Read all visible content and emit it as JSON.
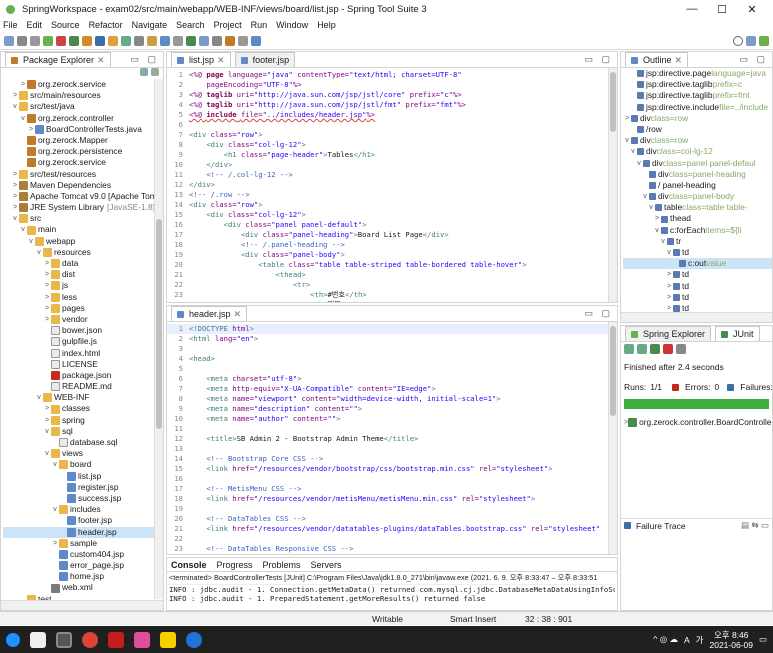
{
  "window": {
    "title": "SpringWorkspace - exam02/src/main/webapp/WEB-INF/views/board/list.jsp - Spring Tool Suite 3",
    "min": "—",
    "max": "☐",
    "close": "✕"
  },
  "menu": [
    "File",
    "Edit",
    "Source",
    "Refactor",
    "Navigate",
    "Search",
    "Project",
    "Run",
    "Window",
    "Help"
  ],
  "package_explorer": {
    "tab": "Package Explorer",
    "items": [
      {
        "indent": 2,
        "arrow": ">",
        "icon": "pkg",
        "label": "org.zerock.service"
      },
      {
        "indent": 1,
        "arrow": ">",
        "icon": "folder",
        "label": "src/main/resources"
      },
      {
        "indent": 1,
        "arrow": "v",
        "icon": "folder",
        "label": "src/test/java"
      },
      {
        "indent": 2,
        "arrow": "v",
        "icon": "pkg",
        "label": "org.zerock.controller"
      },
      {
        "indent": 3,
        "arrow": ">",
        "icon": "jfile",
        "label": "BoardControllerTests.java"
      },
      {
        "indent": 2,
        "arrow": "",
        "icon": "pkg",
        "label": "org.zerock.Mapper"
      },
      {
        "indent": 2,
        "arrow": "",
        "icon": "pkg",
        "label": "org.zerock.persistence"
      },
      {
        "indent": 2,
        "arrow": "",
        "icon": "pkg",
        "label": "org.zerock.service"
      },
      {
        "indent": 1,
        "arrow": ">",
        "icon": "folder",
        "label": "src/test/resources"
      },
      {
        "indent": 1,
        "arrow": ">",
        "icon": "jar",
        "label": "Maven Dependencies"
      },
      {
        "indent": 1,
        "arrow": ">",
        "icon": "jar",
        "label": "Apache Tomcat v9.0 [Apache Tom"
      },
      {
        "indent": 1,
        "arrow": ">",
        "icon": "jar",
        "label": "JRE System Library",
        "suffix": "[JavaSE-1.8]"
      },
      {
        "indent": 1,
        "arrow": "v",
        "icon": "folder",
        "label": "src"
      },
      {
        "indent": 2,
        "arrow": "v",
        "icon": "folder",
        "label": "main"
      },
      {
        "indent": 3,
        "arrow": "v",
        "icon": "folder",
        "label": "webapp"
      },
      {
        "indent": 4,
        "arrow": "v",
        "icon": "folder",
        "label": "resources"
      },
      {
        "indent": 5,
        "arrow": ">",
        "icon": "folder",
        "label": "data"
      },
      {
        "indent": 5,
        "arrow": ">",
        "icon": "folder",
        "label": "dist"
      },
      {
        "indent": 5,
        "arrow": ">",
        "icon": "folder",
        "label": "js"
      },
      {
        "indent": 5,
        "arrow": ">",
        "icon": "folder",
        "label": "less"
      },
      {
        "indent": 5,
        "arrow": ">",
        "icon": "folder",
        "label": "pages"
      },
      {
        "indent": 5,
        "arrow": ">",
        "icon": "folder",
        "label": "vendor"
      },
      {
        "indent": 5,
        "arrow": "",
        "icon": "file",
        "label": "bower.json"
      },
      {
        "indent": 5,
        "arrow": "",
        "icon": "file",
        "label": "gulpfile.js"
      },
      {
        "indent": 5,
        "arrow": "",
        "icon": "file",
        "label": "index.html"
      },
      {
        "indent": 5,
        "arrow": "",
        "icon": "file",
        "label": "LICENSE"
      },
      {
        "indent": 5,
        "arrow": "",
        "icon": "red",
        "label": "package.json"
      },
      {
        "indent": 5,
        "arrow": "",
        "icon": "file",
        "label": "README.md"
      },
      {
        "indent": 4,
        "arrow": "v",
        "icon": "folder",
        "label": "WEB-INF"
      },
      {
        "indent": 5,
        "arrow": ">",
        "icon": "folder",
        "label": "classes"
      },
      {
        "indent": 5,
        "arrow": ">",
        "icon": "folder",
        "label": "spring"
      },
      {
        "indent": 5,
        "arrow": "v",
        "icon": "folder",
        "label": "sql"
      },
      {
        "indent": 6,
        "arrow": "",
        "icon": "file",
        "label": "database.sql"
      },
      {
        "indent": 5,
        "arrow": "v",
        "icon": "folder",
        "label": "views"
      },
      {
        "indent": 6,
        "arrow": "v",
        "icon": "folder",
        "label": "board"
      },
      {
        "indent": 7,
        "arrow": "",
        "icon": "jsp",
        "label": "list.jsp"
      },
      {
        "indent": 7,
        "arrow": "",
        "icon": "jsp",
        "label": "register.jsp"
      },
      {
        "indent": 7,
        "arrow": "",
        "icon": "jsp",
        "label": "success.jsp"
      },
      {
        "indent": 6,
        "arrow": "v",
        "icon": "folder",
        "label": "includes"
      },
      {
        "indent": 7,
        "arrow": "",
        "icon": "jsp",
        "label": "footer.jsp"
      },
      {
        "indent": 7,
        "arrow": "",
        "icon": "jsp",
        "label": "header.jsp",
        "selected": true
      },
      {
        "indent": 6,
        "arrow": ">",
        "icon": "folder",
        "label": "sample"
      },
      {
        "indent": 6,
        "arrow": "",
        "icon": "jsp",
        "label": "custom404.jsp"
      },
      {
        "indent": 6,
        "arrow": "",
        "icon": "jsp",
        "label": "error_page.jsp"
      },
      {
        "indent": 6,
        "arrow": "",
        "icon": "jsp",
        "label": "home.jsp"
      },
      {
        "indent": 5,
        "arrow": "",
        "icon": "tag",
        "label": "web.xml"
      },
      {
        "indent": 2,
        "arrow": "",
        "icon": "folder",
        "label": "test"
      },
      {
        "indent": 1,
        "arrow": ">",
        "icon": "folder",
        "label": "target"
      }
    ]
  },
  "editor_top": {
    "tabs": [
      "list.jsp",
      "footer.jsp"
    ],
    "lines": [
      {
        "n": "1",
        "html": "<span class=\"at\">&lt;%@</span> <span class=\"kw\">page</span> <span class=\"at\">language=</span><span class=\"st\">\"java\"</span> <span class=\"at\">contentType=</span><span class=\"st\">\"text/html; charset=UTF-8\"</span>"
      },
      {
        "n": "2",
        "html": "    <span class=\"at\">pageEncoding=</span><span class=\"st\">\"UTF-8\"</span><span class=\"at\">%&gt;</span>"
      },
      {
        "n": "3",
        "html": "<span class=\"at\">&lt;%@</span> <span class=\"kw\">taglib</span> <span class=\"at\">uri=</span><span class=\"st\">\"http://java.sun.com/jsp/jstl/core\"</span> <span class=\"at\">prefix=</span><span class=\"st\">\"c\"</span><span class=\"at\">%&gt;</span>"
      },
      {
        "n": "4",
        "html": "<span class=\"at\">&lt;%@</span> <span class=\"kw\">taglib</span> <span class=\"at\">uri=</span><span class=\"st\">\"http://java.sun.com/jsp/jstl/fmt\"</span> <span class=\"at\">prefix=</span><span class=\"st\">\"fmt\"</span><span class=\"at\">%&gt;</span>"
      },
      {
        "n": "5",
        "html": "<span class=\"at\">&lt;%@</span> <span class=\"kw\">include</span> <span class=\"at\">file=</span><span class=\"st\">\"../includes/header.jsp\"</span><span class=\"at\">%&gt;</span>"
      },
      {
        "n": "6",
        "html": ""
      },
      {
        "n": "7",
        "html": "<span class=\"tg\">&lt;div</span> <span class=\"at\">class=</span><span class=\"st\">\"row\"</span><span class=\"tg\">&gt;</span>"
      },
      {
        "n": "8",
        "html": "    <span class=\"tg\">&lt;div</span> <span class=\"at\">class=</span><span class=\"st\">\"col-lg-12\"</span><span class=\"tg\">&gt;</span>"
      },
      {
        "n": "9",
        "html": "        <span class=\"tg\">&lt;h1</span> <span class=\"at\">class=</span><span class=\"st\">\"page-header\"</span><span class=\"tg\">&gt;</span>Tables<span class=\"tg\">&lt;/h1&gt;</span>"
      },
      {
        "n": "10",
        "html": "    <span class=\"tg\">&lt;/div&gt;</span>"
      },
      {
        "n": "11",
        "html": "    <span class=\"cm\">&lt;!-- /.col-lg-12 --&gt;</span>"
      },
      {
        "n": "12",
        "html": "<span class=\"tg\">&lt;/div&gt;</span>"
      },
      {
        "n": "13",
        "html": "<span class=\"cm\">&lt;!-- /.row --&gt;</span>"
      },
      {
        "n": "14",
        "html": "<span class=\"tg\">&lt;div</span> <span class=\"at\">class=</span><span class=\"st\">\"row\"</span><span class=\"tg\">&gt;</span>"
      },
      {
        "n": "15",
        "html": "    <span class=\"tg\">&lt;div</span> <span class=\"at\">class=</span><span class=\"st\">\"col-lg-12\"</span><span class=\"tg\">&gt;</span>"
      },
      {
        "n": "16",
        "html": "        <span class=\"tg\">&lt;div</span> <span class=\"at\">class=</span><span class=\"st\">\"panel panel-default\"</span><span class=\"tg\">&gt;</span>"
      },
      {
        "n": "17",
        "html": "            <span class=\"tg\">&lt;div</span> <span class=\"at\">class=</span><span class=\"st\">\"panel-heading\"</span><span class=\"tg\">&gt;</span>Board List Page<span class=\"tg\">&lt;/div&gt;</span>"
      },
      {
        "n": "18",
        "html": "            <span class=\"cm\">&lt;!-- /.panel-heading --&gt;</span>"
      },
      {
        "n": "19",
        "html": "            <span class=\"tg\">&lt;div</span> <span class=\"at\">class=</span><span class=\"st\">\"panel-body\"</span><span class=\"tg\">&gt;</span>"
      },
      {
        "n": "20",
        "html": "                <span class=\"tg\">&lt;table</span> <span class=\"at\">class=</span><span class=\"st\">\"table table-striped table-bordered table-hover\"</span><span class=\"tg\">&gt;</span>"
      },
      {
        "n": "21",
        "html": "                    <span class=\"tg\">&lt;thead&gt;</span>"
      },
      {
        "n": "22",
        "html": "                        <span class=\"tg\">&lt;tr&gt;</span>"
      },
      {
        "n": "23",
        "html": "                            <span class=\"tg\">&lt;th&gt;</span>#번호<span class=\"tg\">&lt;/th&gt;</span>"
      },
      {
        "n": "24",
        "html": "                            <span class=\"tg\">&lt;th&gt;</span>제목<span class=\"tg\">&lt;/th&gt;</span>"
      }
    ]
  },
  "editor_bottom": {
    "tab": "header.jsp",
    "lines": [
      {
        "n": "1",
        "html": "<span class=\"tg\">&lt;!DOCTYPE</span> <span class=\"at\">html</span><span class=\"tg\">&gt;</span>"
      },
      {
        "n": "2",
        "html": "<span class=\"tg\">&lt;html</span> <span class=\"at\">lang=</span><span class=\"st\">\"en\"</span><span class=\"tg\">&gt;</span>"
      },
      {
        "n": "3",
        "html": ""
      },
      {
        "n": "4",
        "html": "<span class=\"tg\">&lt;head&gt;</span>"
      },
      {
        "n": "5",
        "html": ""
      },
      {
        "n": "6",
        "html": "    <span class=\"tg\">&lt;meta</span> <span class=\"at\">charset=</span><span class=\"st\">\"utf-8\"</span><span class=\"tg\">&gt;</span>"
      },
      {
        "n": "7",
        "html": "    <span class=\"tg\">&lt;meta</span> <span class=\"at\">http-equiv=</span><span class=\"st\">\"X-UA-Compatible\"</span> <span class=\"at\">content=</span><span class=\"st\">\"IE=edge\"</span><span class=\"tg\">&gt;</span>"
      },
      {
        "n": "8",
        "html": "    <span class=\"tg\">&lt;meta</span> <span class=\"at\">name=</span><span class=\"st\">\"viewport\"</span> <span class=\"at\">content=</span><span class=\"st\">\"width=device-width, initial-scale=1\"</span><span class=\"tg\">&gt;</span>"
      },
      {
        "n": "9",
        "html": "    <span class=\"tg\">&lt;meta</span> <span class=\"at\">name=</span><span class=\"st\">\"description\"</span> <span class=\"at\">content=</span><span class=\"st\">\"\"</span><span class=\"tg\">&gt;</span>"
      },
      {
        "n": "10",
        "html": "    <span class=\"tg\">&lt;meta</span> <span class=\"at\">name=</span><span class=\"st\">\"author\"</span> <span class=\"at\">content=</span><span class=\"st\">\"\"</span><span class=\"tg\">&gt;</span>"
      },
      {
        "n": "11",
        "html": ""
      },
      {
        "n": "12",
        "html": "    <span class=\"tg\">&lt;title&gt;</span>SB Admin 2 - Bootstrap Admin Theme<span class=\"tg\">&lt;/title&gt;</span>"
      },
      {
        "n": "13",
        "html": ""
      },
      {
        "n": "14",
        "html": "    <span class=\"cm\">&lt;!-- Bootstrap Core CSS --&gt;</span>"
      },
      {
        "n": "15",
        "html": "    <span class=\"tg\">&lt;link</span> <span class=\"at\">href=</span><span class=\"st\">\"/resources/vendor/bootstrap/css/bootstrap.min.css\"</span> <span class=\"at\">rel=</span><span class=\"st\">\"stylesheet\"</span><span class=\"tg\">&gt;</span>"
      },
      {
        "n": "16",
        "html": ""
      },
      {
        "n": "17",
        "html": "    <span class=\"cm\">&lt;!-- MetisMenu CSS --&gt;</span>"
      },
      {
        "n": "18",
        "html": "    <span class=\"tg\">&lt;link</span> <span class=\"at\">href=</span><span class=\"st\">\"/resources/vendor/metisMenu/metisMenu.min.css\"</span> <span class=\"at\">rel=</span><span class=\"st\">\"stylesheet\"</span><span class=\"tg\">&gt;</span>"
      },
      {
        "n": "19",
        "html": ""
      },
      {
        "n": "20",
        "html": "    <span class=\"cm\">&lt;!-- DataTables CSS --&gt;</span>"
      },
      {
        "n": "21",
        "html": "    <span class=\"tg\">&lt;link</span> <span class=\"at\">href=</span><span class=\"st\">\"/resources/vendor/datatables-plugins/dataTables.bootstrap.css\"</span> <span class=\"at\">rel=</span><span class=\"st\">\"stylesheet\"</span>"
      },
      {
        "n": "22",
        "html": ""
      },
      {
        "n": "23",
        "html": "    <span class=\"cm\">&lt;!-- DataTables Responsive CSS --&gt;</span>"
      },
      {
        "n": "24",
        "html": "    <span class=\"tg\">&lt;link</span> <span class=\"at\">href=</span><span class=\"st\">\"/resources/vendor/datatables-responsive/dataTables.responsive.css\"</span> <span class=\"at\">rel=</span><span class=\"st\">\"styleshe</span>"
      }
    ]
  },
  "outline": {
    "tab": "Outline",
    "items": [
      {
        "indent": 1,
        "label": "jsp:directive.page",
        "attr": " language=java"
      },
      {
        "indent": 1,
        "label": "jsp:directive.taglib",
        "attr": " prefix=c"
      },
      {
        "indent": 1,
        "label": "jsp:directive.taglib",
        "attr": " prefix=fmt"
      },
      {
        "indent": 1,
        "label": "jsp:directive.include",
        "attr": " file=../include"
      },
      {
        "indent": 0,
        "arrow": ">",
        "label": "div",
        "attr": " class=row"
      },
      {
        "indent": 1,
        "label": "/row",
        "attr": ""
      },
      {
        "indent": 0,
        "arrow": "v",
        "label": "div",
        "attr": " class=row"
      },
      {
        "indent": 1,
        "arrow": "v",
        "label": "div",
        "attr": " class=col-lg-12"
      },
      {
        "indent": 2,
        "arrow": "v",
        "label": "div",
        "attr": " class=panel panel-defaul"
      },
      {
        "indent": 3,
        "label": "div",
        "attr": " class=panel-heading"
      },
      {
        "indent": 3,
        "label": "/ panel-heading",
        "attr": ""
      },
      {
        "indent": 3,
        "arrow": "v",
        "label": "div",
        "attr": " class=panel-body"
      },
      {
        "indent": 4,
        "arrow": "v",
        "label": "table",
        "attr": " class=table table-"
      },
      {
        "indent": 5,
        "arrow": ">",
        "label": "thead",
        "attr": ""
      },
      {
        "indent": 5,
        "arrow": "v",
        "label": "c:forEach",
        "attr": " items=${li"
      },
      {
        "indent": 6,
        "arrow": "v",
        "label": "tr",
        "attr": ""
      },
      {
        "indent": 7,
        "arrow": "v",
        "label": "td",
        "attr": ""
      },
      {
        "indent": 8,
        "label": "c:out",
        "attr": " value",
        "selected": true
      },
      {
        "indent": 7,
        "arrow": ">",
        "label": "td",
        "attr": ""
      },
      {
        "indent": 7,
        "arrow": ">",
        "label": "td",
        "attr": ""
      },
      {
        "indent": 7,
        "arrow": ">",
        "label": "td",
        "attr": ""
      },
      {
        "indent": 7,
        "arrow": ">",
        "label": "td",
        "attr": ""
      },
      {
        "indent": 4,
        "label": "Modal 추가",
        "attr": ""
      }
    ]
  },
  "junit": {
    "tabs": [
      "Spring Explorer",
      "JUnit"
    ],
    "finished": "Finished after 2.4 seconds",
    "runs_label": "Runs:",
    "runs": "1/1",
    "errors_label": "Errors:",
    "errors": "0",
    "failures_label": "Failures:",
    "failures": "0",
    "test_item": "org.zerock.controller.BoardControllerT",
    "failure_trace": "Failure Trace"
  },
  "console": {
    "tabs": [
      "Console",
      "Progress",
      "Problems",
      "Servers"
    ],
    "header": "<terminated> BoardControllerTests [JUnit] C:\\Program Files\\Java\\jdk1.8.0_271\\bin\\javaw.exe  (2021. 6. 9. 오후 8:33:47 – 오후 8:33:51",
    "lines": [
      "INFO : jdbc.audit - 1. Connection.getMetaData() returned com.mysql.cj.jdbc.DatabaseMetaDataUsingInfoSch",
      "INFO : jdbc.audit - 1. PreparedStatement.getMoreResults() returned false"
    ]
  },
  "status": {
    "mode": "Writable",
    "insert": "Smart Insert",
    "pos": "32 : 38 : 901"
  },
  "taskbar": {
    "time": "오후 8:46",
    "date": "2021-06-09",
    "lang": "A",
    "ime": "가"
  }
}
